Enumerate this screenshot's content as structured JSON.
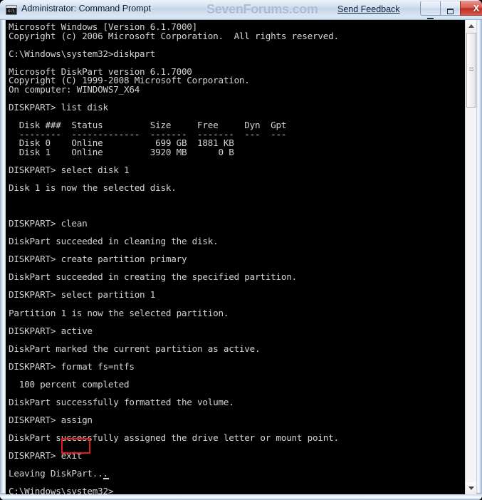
{
  "window": {
    "title": "Administrator: Command Prompt",
    "icon": "command-prompt-icon",
    "watermark": "SevenForums.com",
    "send_feedback": "Send Feedback",
    "controls": {
      "minimize": "minimize-button",
      "maximize": "maximize-button",
      "close_symbol": "X"
    },
    "accent_color": "#bed1e8",
    "close_color": "#bc2d20"
  },
  "console": {
    "background_color": "#000000",
    "text_color": "#d4d4d4",
    "lines": [
      "Microsoft Windows [Version 6.1.7000]",
      "Copyright (c) 2006 Microsoft Corporation.  All rights reserved.",
      "",
      "C:\\Windows\\system32>diskpart",
      "",
      "Microsoft DiskPart version 6.1.7000",
      "Copyright (C) 1999-2008 Microsoft Corporation.",
      "On computer: WINDOWS7_X64",
      "",
      "DISKPART> list disk",
      "",
      "  Disk ###  Status         Size     Free     Dyn  Gpt",
      "  --------  -------------  -------  -------  ---  ---",
      "  Disk 0    Online          699 GB  1881 KB",
      "  Disk 1    Online         3920 MB      0 B",
      "",
      "DISKPART> select disk 1",
      "",
      "Disk 1 is now the selected disk.",
      "",
      "",
      "",
      "DISKPART> clean",
      "",
      "DiskPart succeeded in cleaning the disk.",
      "",
      "DISKPART> create partition primary",
      "",
      "DiskPart succeeded in creating the specified partition.",
      "",
      "DISKPART> select partition 1",
      "",
      "Partition 1 is now the selected partition.",
      "",
      "DISKPART> active",
      "",
      "DiskPart marked the current partition as active.",
      "",
      "DISKPART> format fs=ntfs",
      "",
      "  100 percent completed",
      "",
      "DiskPart successfully formatted the volume.",
      "",
      "DISKPART> assign",
      "",
      "DiskPart successfully assigned the drive letter or mount point.",
      "",
      "DISKPART> exit",
      "",
      "Leaving DiskPart...",
      "",
      "C:\\Windows\\system32>"
    ],
    "highlighted_command": "exit",
    "highlight_color": "#e41b17",
    "cursor": "_"
  },
  "scrollbar": {
    "up_arrow": "scroll-up-arrow",
    "down_arrow": "scroll-down-arrow",
    "thumb": "scroll-thumb"
  }
}
